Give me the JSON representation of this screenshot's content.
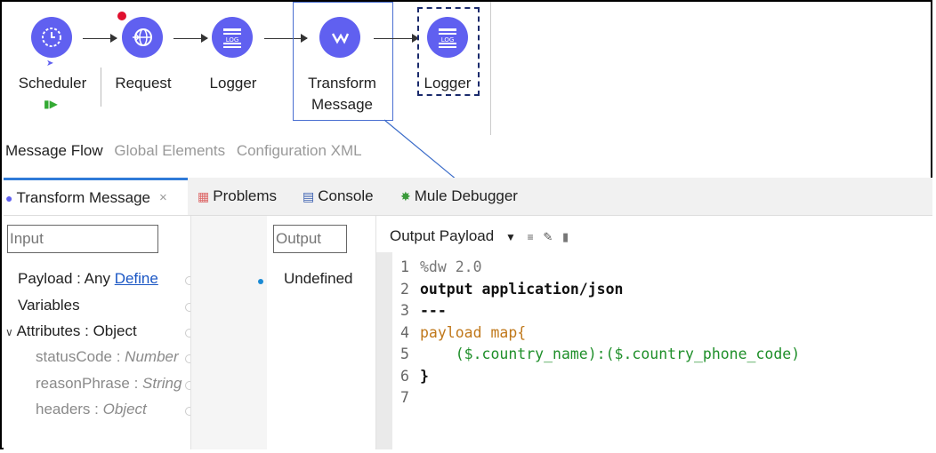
{
  "flow": {
    "nodes": [
      {
        "label": "Scheduler",
        "icon": "clock-icon"
      },
      {
        "label": "Request",
        "icon": "globe-icon"
      },
      {
        "label": "Logger",
        "icon": "log-icon",
        "badge": "LOG"
      },
      {
        "label": "Transform\nMessage",
        "icon": "transform-icon"
      },
      {
        "label": "Logger",
        "icon": "log-icon",
        "badge": "LOG"
      }
    ],
    "colors": {
      "node": "#6060f0",
      "error_dot": "#e0102e",
      "selection": "#4a6fd1"
    }
  },
  "flow_tabs": [
    "Message Flow",
    "Global Elements",
    "Configuration XML"
  ],
  "tabs": [
    {
      "label": "Transform Message",
      "icon": "transform-icon"
    },
    {
      "label": "Problems",
      "icon": "problems-icon"
    },
    {
      "label": "Console",
      "icon": "console-icon"
    },
    {
      "label": "Mule Debugger",
      "icon": "debugger-icon"
    }
  ],
  "input_pane": {
    "search_placeholder": "Input",
    "payload_label": "Payload : Any",
    "define_link": "Define",
    "variables_label": "Variables",
    "attributes_label": "Attributes : Object",
    "attrs": [
      {
        "name": "statusCode",
        "type": "Number"
      },
      {
        "name": "reasonPhrase",
        "type": "String"
      },
      {
        "name": "headers",
        "type": "Object"
      }
    ]
  },
  "output_pane": {
    "search_placeholder": "Output",
    "value": "Undefined"
  },
  "code_pane": {
    "header_output": "Output",
    "header_target": "Payload",
    "lines": [
      {
        "n": "1",
        "text": "%dw 2.0"
      },
      {
        "n": "2",
        "text": "output application/json"
      },
      {
        "n": "3",
        "text": "---"
      },
      {
        "n": "4",
        "text": "payload map{"
      },
      {
        "n": "5",
        "text": "    ($.country_name):($.country_phone_code)"
      },
      {
        "n": "6",
        "text": "}"
      },
      {
        "n": "7",
        "text": ""
      }
    ]
  }
}
